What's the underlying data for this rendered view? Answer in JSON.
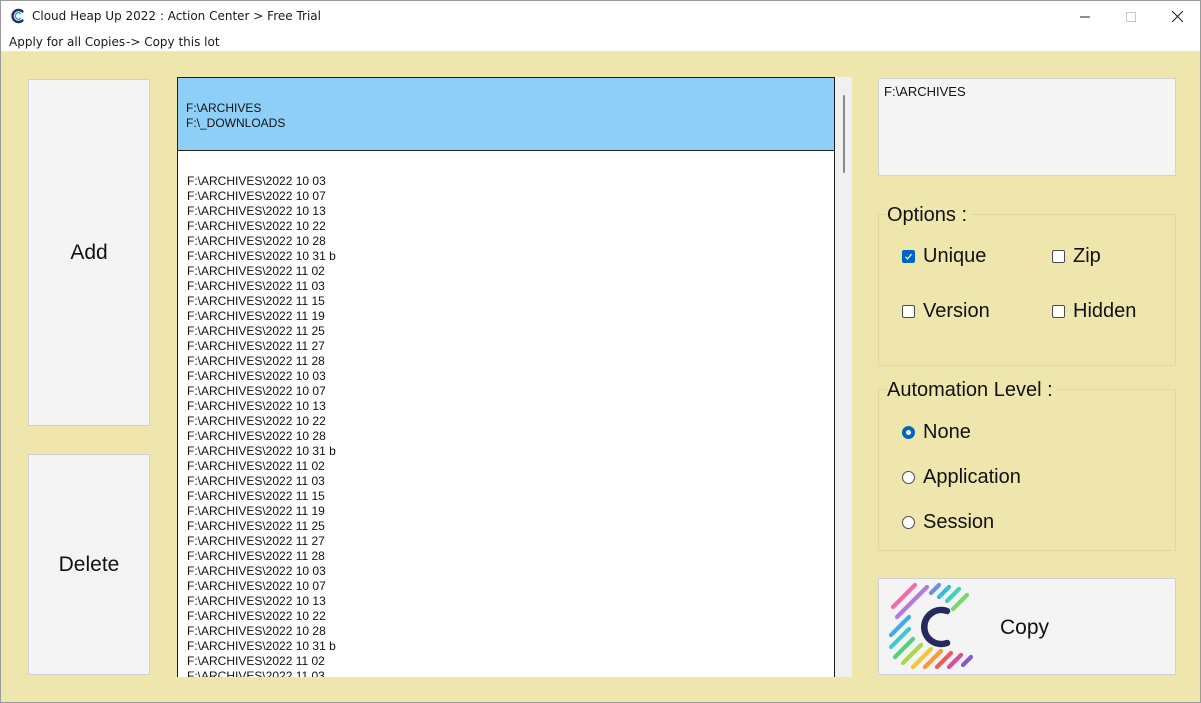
{
  "window": {
    "title": "Cloud Heap Up 2022 : Action Center > Free Trial",
    "icon": "app-logo-icon"
  },
  "menu": {
    "apply_all": "Apply for all Copies",
    "copy_lot": "-> Copy this lot"
  },
  "buttons": {
    "add": "Add",
    "delete": "Delete",
    "copy": "Copy"
  },
  "sources": {
    "selected": [
      "F:\\ARCHIVES",
      "F:\\_DOWNLOADS"
    ],
    "entries": [
      "F:\\ARCHIVES\\2022 10 03",
      "F:\\ARCHIVES\\2022 10 07",
      "F:\\ARCHIVES\\2022 10 13",
      "F:\\ARCHIVES\\2022 10 22",
      "F:\\ARCHIVES\\2022 10 28",
      "F:\\ARCHIVES\\2022 10 31 b",
      "F:\\ARCHIVES\\2022 11 02",
      "F:\\ARCHIVES\\2022 11 03",
      "F:\\ARCHIVES\\2022 11 15",
      "F:\\ARCHIVES\\2022 11 19",
      "F:\\ARCHIVES\\2022 11 25",
      "F:\\ARCHIVES\\2022 11 27",
      "F:\\ARCHIVES\\2022 11 28",
      "F:\\ARCHIVES\\2022 10 03",
      "F:\\ARCHIVES\\2022 10 07",
      "F:\\ARCHIVES\\2022 10 13",
      "F:\\ARCHIVES\\2022 10 22",
      "F:\\ARCHIVES\\2022 10 28",
      "F:\\ARCHIVES\\2022 10 31 b",
      "F:\\ARCHIVES\\2022 11 02",
      "F:\\ARCHIVES\\2022 11 03",
      "F:\\ARCHIVES\\2022 11 15",
      "F:\\ARCHIVES\\2022 11 19",
      "F:\\ARCHIVES\\2022 11 25",
      "F:\\ARCHIVES\\2022 11 27",
      "F:\\ARCHIVES\\2022 11 28",
      "F:\\ARCHIVES\\2022 10 03",
      "F:\\ARCHIVES\\2022 10 07",
      "F:\\ARCHIVES\\2022 10 13",
      "F:\\ARCHIVES\\2022 10 22",
      "F:\\ARCHIVES\\2022 10 28",
      "F:\\ARCHIVES\\2022 10 31 b",
      "F:\\ARCHIVES\\2022 11 02",
      "F:\\ARCHIVES\\2022 11 03"
    ]
  },
  "destination": {
    "path": "F:\\ARCHIVES"
  },
  "options": {
    "title": "Options :",
    "unique": {
      "label": "Unique",
      "checked": true
    },
    "zip": {
      "label": "Zip",
      "checked": false
    },
    "version": {
      "label": "Version",
      "checked": false
    },
    "hidden": {
      "label": "Hidden",
      "checked": false
    }
  },
  "automation": {
    "title": "Automation Level :",
    "selected": "None",
    "levels": [
      "None",
      "Application",
      "Session"
    ]
  },
  "colors": {
    "background": "#efe6ad",
    "selection": "#8ecff8",
    "accent": "#0067c0"
  }
}
